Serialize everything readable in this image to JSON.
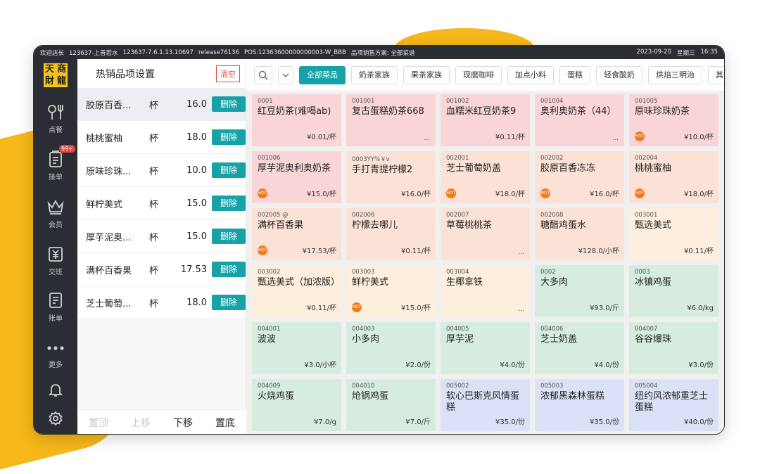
{
  "status_bar": {
    "items": [
      "欢迎店长",
      "123637-上善若水",
      "123637-7.6.1.13.10697",
      "release76136",
      "POS:12363600000000003-W_BBB",
      "品项销售方案: 全部菜谱"
    ],
    "date": "2023-09-20",
    "weekday": "星期三",
    "time": "16:35"
  },
  "logo": [
    "天",
    "商",
    "財",
    "龍"
  ],
  "nav": {
    "items": [
      {
        "label": "点餐",
        "icon": "fork-knife-icon"
      },
      {
        "label": "接单",
        "icon": "clipboard-icon",
        "badge": "99+"
      },
      {
        "label": "会员",
        "icon": "crown-icon"
      },
      {
        "label": "交班",
        "icon": "cash-register-icon"
      },
      {
        "label": "账单",
        "icon": "bill-icon"
      },
      {
        "label": "更多",
        "icon": "more-icon"
      }
    ],
    "bottom_icons": [
      "bell-icon",
      "settings-icon"
    ]
  },
  "left_panel": {
    "title": "热销品项设置",
    "clear_label": "清空",
    "delete_label": "删除",
    "rows": [
      {
        "name": "胶原百香...",
        "unit": "杯",
        "price": "16.0"
      },
      {
        "name": "桃桃蜜柚",
        "unit": "杯",
        "price": "18.0"
      },
      {
        "name": "原味珍珠...",
        "unit": "杯",
        "price": "10.0"
      },
      {
        "name": "鲜柠美式",
        "unit": "杯",
        "price": "15.0"
      },
      {
        "name": "厚芋泥奥...",
        "unit": "杯",
        "price": "15.0"
      },
      {
        "name": "满杯百香果",
        "unit": "杯",
        "price": "17.53"
      },
      {
        "name": "芝士葡萄...",
        "unit": "杯",
        "price": "18.0"
      }
    ],
    "footer": {
      "top": "置顶",
      "up": "上移",
      "down": "下移",
      "bottom": "置底"
    }
  },
  "categories": [
    "全部菜品",
    "奶茶家族",
    "果茶家族",
    "现磨咖啡",
    "加点小料",
    "蛋糕",
    "轻食酸奶",
    "烘焙三明治",
    "其他"
  ],
  "hot_label": "HOT",
  "dishes": [
    {
      "code": "0001",
      "name": "红豆奶茶(难喝ab)",
      "price": "¥0.01/杯",
      "color": "pink"
    },
    {
      "code": "001001",
      "name": "复古蛋糕奶茶668",
      "price": "...",
      "color": "pink"
    },
    {
      "code": "001002",
      "name": "血糯米红豆奶茶9",
      "price": "¥0.11/杯",
      "color": "pink"
    },
    {
      "code": "001004",
      "name": "奥利奥奶茶（44）",
      "price": "...",
      "color": "pink"
    },
    {
      "code": "001005",
      "name": "原味珍珠奶茶",
      "price": "¥10.0/杯",
      "color": "pink",
      "hot": true
    },
    {
      "code": "001006",
      "name": "厚芋泥奥利奥奶茶",
      "price": "¥15.0/杯",
      "color": "pink",
      "hot": true
    },
    {
      "code": "0003YY%￥v",
      "name": "手打青提柠檬2",
      "price": "¥16.0/杯",
      "color": "peach"
    },
    {
      "code": "002001",
      "name": "芝士葡萄奶盖",
      "price": "¥18.0/杯",
      "color": "peach",
      "hot": true
    },
    {
      "code": "002002",
      "name": "胶原百香冻冻",
      "price": "¥16.0/杯",
      "color": "peach",
      "hot": true
    },
    {
      "code": "002004",
      "name": "桃桃蜜柚",
      "price": "¥18.0/杯",
      "color": "peach",
      "hot": true
    },
    {
      "code": "002005 @",
      "name": "满杯百香果",
      "price": "¥17.53/杯",
      "color": "peach",
      "hot": true
    },
    {
      "code": "002006",
      "name": "柠檬去哪儿",
      "price": "¥0.11/杯",
      "color": "peach"
    },
    {
      "code": "002007",
      "name": "草莓桃桃茶",
      "price": "...",
      "color": "peach"
    },
    {
      "code": "002008",
      "name": "糖醋鸡蛋水",
      "price": "¥128.0/小杯",
      "color": "peach"
    },
    {
      "code": "003001",
      "name": "甄选美式",
      "price": "¥0.11/杯",
      "color": "cream"
    },
    {
      "code": "003002",
      "name": "甄选美式（加浓版）",
      "price": "¥0.11/杯",
      "color": "cream"
    },
    {
      "code": "003003",
      "name": "鲜柠美式",
      "price": "¥15.0/杯",
      "color": "cream",
      "hot": true
    },
    {
      "code": "003004",
      "name": "生椰拿铁",
      "price": "...",
      "color": "cream"
    },
    {
      "code": "0002",
      "name": "大多肉",
      "price": "¥93.0/斤",
      "color": "green"
    },
    {
      "code": "0003",
      "name": "冰镇鸡蛋",
      "price": "¥6.0/kg",
      "color": "green"
    },
    {
      "code": "004001",
      "name": "波波",
      "price": "¥3.0/小杯",
      "color": "green"
    },
    {
      "code": "004003",
      "name": "小多肉",
      "price": "¥2.0/份",
      "color": "green"
    },
    {
      "code": "004005",
      "name": "厚芋泥",
      "price": "¥4.0/份",
      "color": "green"
    },
    {
      "code": "004006",
      "name": "芝士奶盖",
      "price": "¥4.0/份",
      "color": "green"
    },
    {
      "code": "004007",
      "name": "谷谷爆珠",
      "price": "¥3.0/份",
      "color": "green"
    },
    {
      "code": "004009",
      "name": "火烧鸡蛋",
      "price": "¥7.0/g",
      "color": "green"
    },
    {
      "code": "004010",
      "name": "炝锅鸡蛋",
      "price": "¥7.0/斤",
      "color": "green"
    },
    {
      "code": "005002",
      "name": "软心巴斯克风情蛋糕",
      "price": "¥35.0/份",
      "color": "blue"
    },
    {
      "code": "005003",
      "name": "浓郁黑森林蛋糕",
      "price": "¥35.0/份",
      "color": "blue"
    },
    {
      "code": "005004",
      "name": "纽约风浓郁重芝士蛋糕",
      "price": "¥40.0/份",
      "color": "blue"
    }
  ]
}
